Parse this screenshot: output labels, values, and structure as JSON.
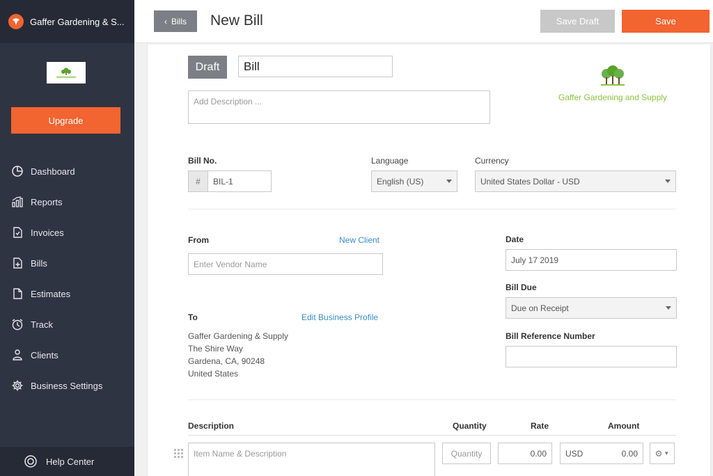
{
  "sidebar": {
    "company": "Gaffer Gardening & S...",
    "upgrade_label": "Upgrade",
    "items": [
      {
        "label": "Dashboard",
        "icon": "dashboard-icon"
      },
      {
        "label": "Reports",
        "icon": "reports-icon"
      },
      {
        "label": "Invoices",
        "icon": "invoices-icon"
      },
      {
        "label": "Bills",
        "icon": "bills-icon"
      },
      {
        "label": "Estimates",
        "icon": "estimates-icon"
      },
      {
        "label": "Track",
        "icon": "track-icon"
      },
      {
        "label": "Clients",
        "icon": "clients-icon"
      },
      {
        "label": "Business Settings",
        "icon": "gear-icon"
      }
    ],
    "help_label": "Help Center"
  },
  "topbar": {
    "back_label": "Bills",
    "title": "New Bill",
    "save_draft_label": "Save Draft",
    "save_label": "Save"
  },
  "bill": {
    "status_badge": "Draft",
    "title_value": "Bill",
    "description_placeholder": "Add Description ...",
    "logo_text": "Gaffer Gardening and Supply"
  },
  "fields": {
    "bill_no_label": "Bill No.",
    "bill_no_prefix": "#",
    "bill_no_value": "BIL-1",
    "language_label": "Language",
    "language_value": "English (US)",
    "currency_label": "Currency",
    "currency_value": "United States Dollar - USD",
    "from_label": "From",
    "new_client_link": "New Client",
    "vendor_placeholder": "Enter Vendor Name",
    "date_label": "Date",
    "date_value": "July 17 2019",
    "bill_due_label": "Bill Due",
    "bill_due_value": "Due on Receipt",
    "to_label": "To",
    "edit_profile_link": "Edit Business Profile",
    "bill_ref_label": "Bill Reference Number",
    "bill_ref_value": "",
    "address": [
      "Gaffer Gardening & Supply",
      "The Shire Way",
      "Gardena, CA, 90248",
      "United States"
    ]
  },
  "line_items": {
    "headers": {
      "description": "Description",
      "quantity": "Quantity",
      "rate": "Rate",
      "amount": "Amount"
    },
    "item_placeholder": "Item Name & Description",
    "quantity_placeholder": "Quantity",
    "rate_value": "0.00",
    "currency_code": "USD",
    "amount_value": "0.00"
  },
  "colors": {
    "accent": "#f26430",
    "sidebar": "#2f3443",
    "link": "#3a8fc7",
    "logo_green": "#8ac43f"
  }
}
